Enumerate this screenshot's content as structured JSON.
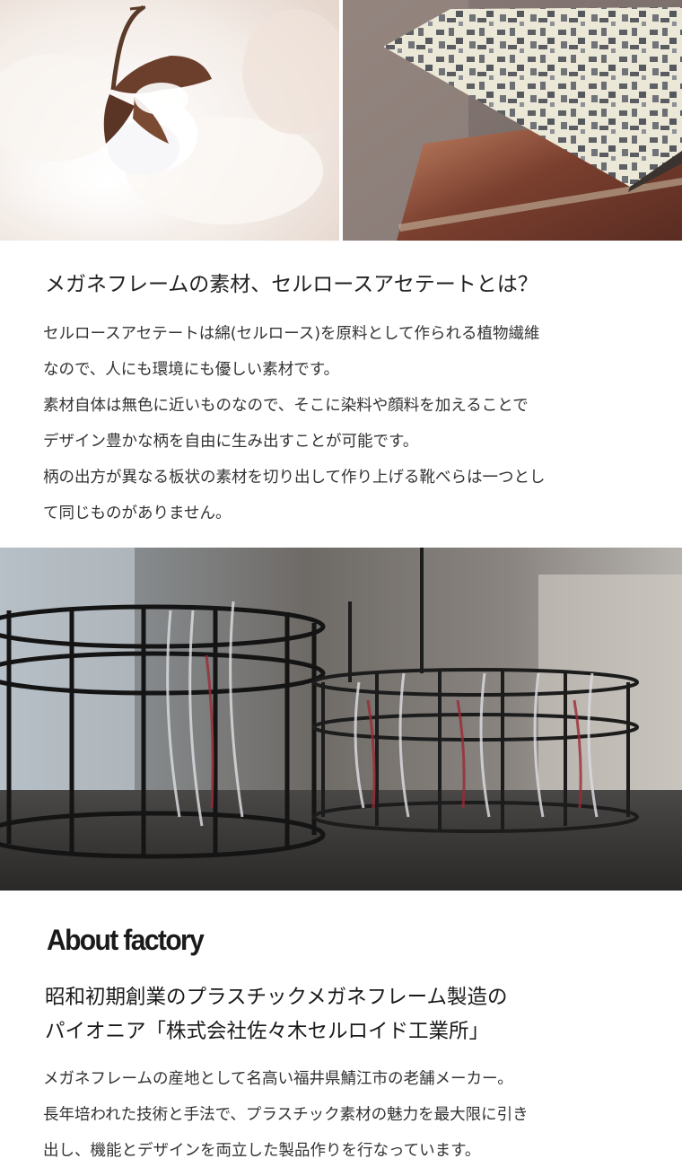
{
  "images": {
    "cotton": "cotton-boll-photo",
    "acetate": "acetate-sheets-photo",
    "factory": "factory-racks-photo"
  },
  "material_section": {
    "heading": "メガネフレームの素材、セルロースアセテートとは？",
    "paragraph_lines": [
      "セルロースアセテートは綿(セルロース)を原料として作られる植物繊維",
      "なので、人にも環境にも優しい素材です。",
      "素材自体は無色に近いものなので、そこに染料や顔料を加えることで",
      "デザイン豊かな柄を自由に生み出すことが可能です。",
      "柄の出方が異なる板状の素材を切り出して作り上げる靴べらは一つとし",
      "て同じものがありません。"
    ]
  },
  "factory_section": {
    "label": "About factory",
    "heading_lines": [
      "昭和初期創業のプラスチックメガネフレーム製造の",
      "パイオニア「株式会社佐々木セルロイド工業所」"
    ],
    "paragraph_lines": [
      "メガネフレームの産地として名高い福井県鯖江市の老舗メーカー。",
      "長年培われた技術と手法で、プラスチック素材の魅力を最大限に引き",
      "出し、機能とデザインを両立した製品作りを行なっています。"
    ]
  },
  "colors": {
    "text": "#222222",
    "background": "#ffffff"
  }
}
